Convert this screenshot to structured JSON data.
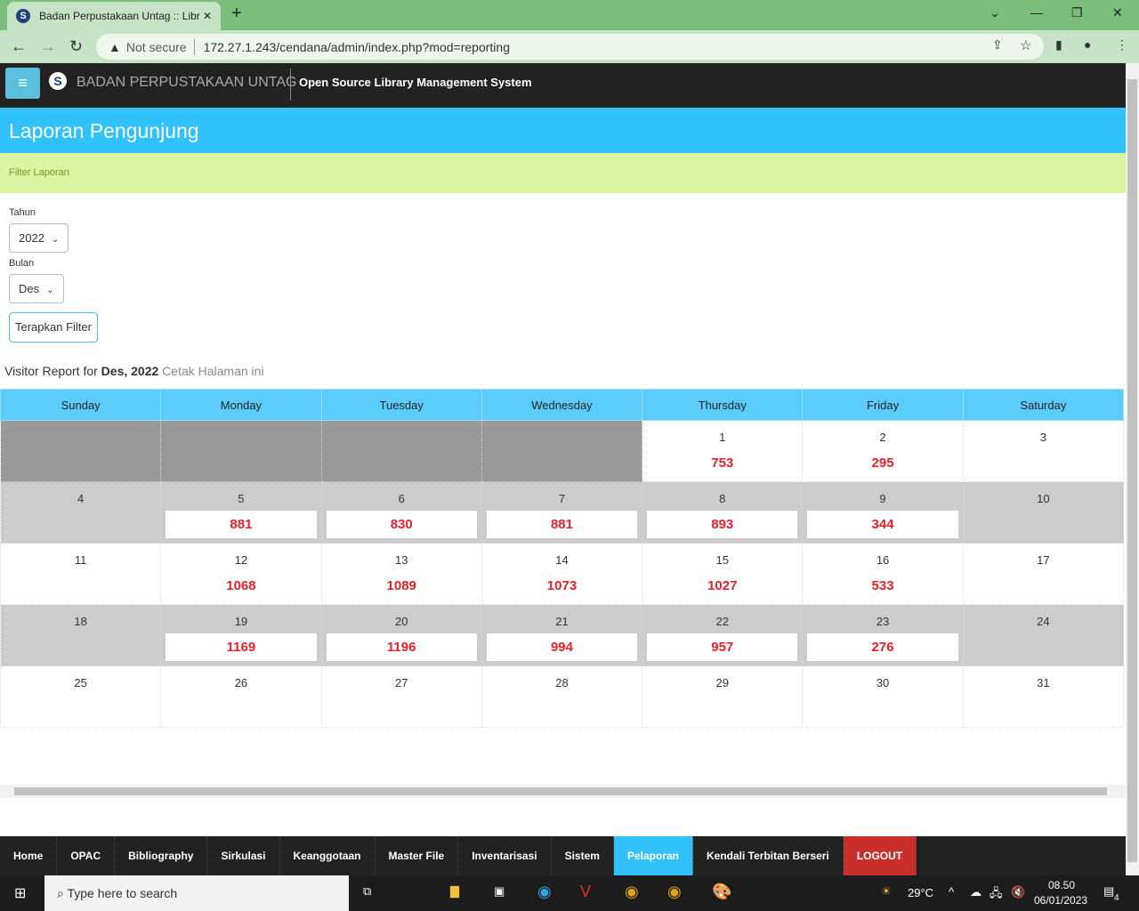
{
  "browser": {
    "tab_title": "Badan Perpustakaan Untag :: Libr",
    "security": "Not secure",
    "url": "172.27.1.243/cendana/admin/index.php?mod=reporting"
  },
  "header": {
    "brand": "BADAN PERPUSTAKAAN UNTAG",
    "subtitle": "Open Source Library Management System"
  },
  "page": {
    "title": "Laporan Pengunjung",
    "filter_label": "Filter Laporan"
  },
  "filter": {
    "year_label": "Tahun",
    "year_value": "2022",
    "month_label": "Bulan",
    "month_value": "Des",
    "apply_label": "Terapkan Filter"
  },
  "report": {
    "prefix": "Visitor Report for",
    "period": "Des, 2022",
    "print_link": "Cetak Halaman ini"
  },
  "calendar": {
    "days": [
      "Sunday",
      "Monday",
      "Tuesday",
      "Wednesday",
      "Thursday",
      "Friday",
      "Saturday"
    ],
    "weeks": [
      [
        null,
        null,
        null,
        null,
        {
          "day": "1",
          "count": "753"
        },
        {
          "day": "2",
          "count": "295"
        },
        {
          "day": "3"
        }
      ],
      [
        {
          "day": "4"
        },
        {
          "day": "5",
          "count": "881"
        },
        {
          "day": "6",
          "count": "830"
        },
        {
          "day": "7",
          "count": "881"
        },
        {
          "day": "8",
          "count": "893"
        },
        {
          "day": "9",
          "count": "344"
        },
        {
          "day": "10"
        }
      ],
      [
        {
          "day": "11"
        },
        {
          "day": "12",
          "count": "1068"
        },
        {
          "day": "13",
          "count": "1089"
        },
        {
          "day": "14",
          "count": "1073"
        },
        {
          "day": "15",
          "count": "1027"
        },
        {
          "day": "16",
          "count": "533"
        },
        {
          "day": "17"
        }
      ],
      [
        {
          "day": "18"
        },
        {
          "day": "19",
          "count": "1169"
        },
        {
          "day": "20",
          "count": "1196"
        },
        {
          "day": "21",
          "count": "994"
        },
        {
          "day": "22",
          "count": "957"
        },
        {
          "day": "23",
          "count": "276"
        },
        {
          "day": "24"
        }
      ],
      [
        {
          "day": "25"
        },
        {
          "day": "26"
        },
        {
          "day": "27"
        },
        {
          "day": "28"
        },
        {
          "day": "29"
        },
        {
          "day": "30"
        },
        {
          "day": "31"
        }
      ]
    ]
  },
  "bottom_nav": [
    {
      "label": "Home"
    },
    {
      "label": "OPAC"
    },
    {
      "label": "Bibliography"
    },
    {
      "label": "Sirkulasi"
    },
    {
      "label": "Keanggotaan"
    },
    {
      "label": "Master File"
    },
    {
      "label": "Inventarisasi"
    },
    {
      "label": "Sistem"
    },
    {
      "label": "Pelaporan",
      "active": true
    },
    {
      "label": "Kendali Terbitan Berseri"
    },
    {
      "label": "LOGOUT",
      "logout": true
    }
  ],
  "taskbar": {
    "search_placeholder": "Type here to search",
    "weather": "29°C",
    "time": "08.50",
    "date": "06/01/2023",
    "notifications": "4"
  },
  "colors": {
    "accent": "#31c1fb",
    "count": "#e8202a",
    "filter_bg": "#d9f5a1",
    "logout": "#c9302c"
  }
}
